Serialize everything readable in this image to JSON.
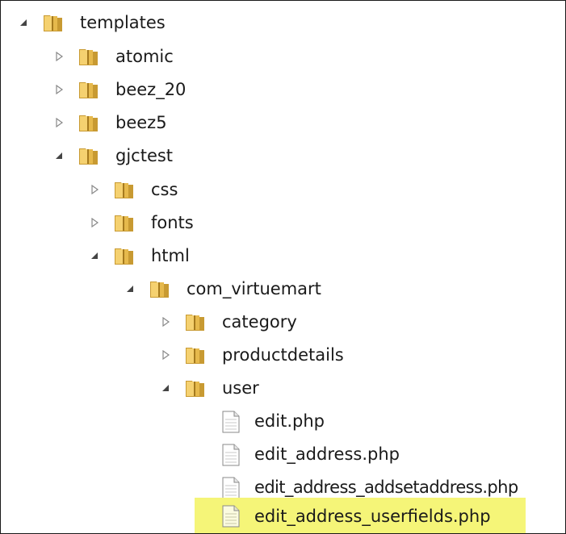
{
  "tree": {
    "items": [
      {
        "label": "templates",
        "kind": "folder",
        "state": "expanded"
      },
      {
        "label": "atomic",
        "kind": "folder",
        "state": "collapsed"
      },
      {
        "label": "beez_20",
        "kind": "folder",
        "state": "collapsed"
      },
      {
        "label": "beez5",
        "kind": "folder",
        "state": "collapsed"
      },
      {
        "label": "gjctest",
        "kind": "folder",
        "state": "expanded"
      },
      {
        "label": "css",
        "kind": "folder",
        "state": "collapsed"
      },
      {
        "label": "fonts",
        "kind": "folder",
        "state": "collapsed"
      },
      {
        "label": "html",
        "kind": "folder",
        "state": "expanded"
      },
      {
        "label": "com_virtuemart",
        "kind": "folder",
        "state": "expanded"
      },
      {
        "label": "category",
        "kind": "folder",
        "state": "collapsed"
      },
      {
        "label": "productdetails",
        "kind": "folder",
        "state": "collapsed"
      },
      {
        "label": "user",
        "kind": "folder",
        "state": "expanded"
      },
      {
        "label": "edit.php",
        "kind": "file"
      },
      {
        "label": "edit_address.php",
        "kind": "file"
      },
      {
        "label": "edit_address_addsetaddress.php",
        "kind": "file"
      },
      {
        "label": "edit_address_userfields.php",
        "kind": "file",
        "selected": true
      }
    ]
  },
  "colors": {
    "highlight": "#f5f578",
    "folder": "#f1c75a",
    "text": "#1a1a1a",
    "border": "#1a1a1a"
  },
  "icons": {
    "expanded": "triangle-filled-icon",
    "collapsed": "triangle-outline-icon",
    "folder": "folder-icon",
    "file": "file-icon"
  }
}
